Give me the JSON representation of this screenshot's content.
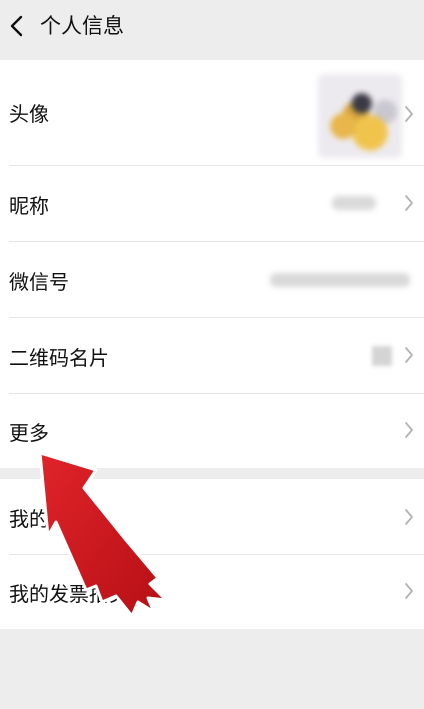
{
  "header": {
    "title": "个人信息",
    "back_icon": "chevron-left-icon"
  },
  "rows": [
    {
      "label": "头像"
    },
    {
      "label": "昵称"
    },
    {
      "label": "微信号"
    },
    {
      "label": "二维码名片"
    },
    {
      "label": "更多"
    },
    {
      "label": "我的地址"
    },
    {
      "label": "我的发票抬头"
    }
  ],
  "overlay": {
    "arrow_color": "#d4161c",
    "arrow_icon": "red-pointer-arrow-icon"
  },
  "colors": {
    "background": "#ededed",
    "row_background": "#ffffff",
    "chevron": "#b2b2b2"
  }
}
